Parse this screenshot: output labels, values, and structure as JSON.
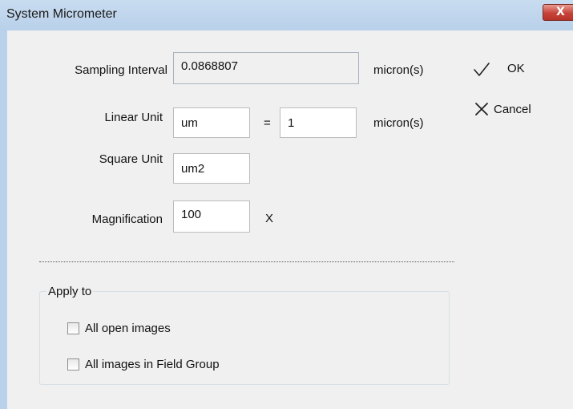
{
  "window": {
    "title": "System Micrometer",
    "close_glyph": "X"
  },
  "form": {
    "sampling_interval": {
      "label": "Sampling Interval",
      "value": "0.0868807",
      "unit": "micron(s)"
    },
    "linear_unit": {
      "label": "Linear Unit",
      "value": "um",
      "equals": "=",
      "factor": "1",
      "unit": "micron(s)"
    },
    "square_unit": {
      "label": "Square Unit",
      "value": "um2"
    },
    "magnification": {
      "label": "Magnification",
      "value": "100",
      "suffix": "X"
    }
  },
  "apply_to": {
    "title": "Apply to",
    "options": [
      {
        "label": "All open images",
        "checked": false
      },
      {
        "label": "All images in Field Group",
        "checked": false
      }
    ]
  },
  "actions": {
    "ok": {
      "label": "OK",
      "icon": "checkmark-icon"
    },
    "cancel": {
      "label": "Cancel",
      "icon": "cross-icon"
    }
  },
  "colors": {
    "titlebar": "#b9d1ea",
    "client_background": "#f0f0f0",
    "close_button": "#c7433a"
  }
}
